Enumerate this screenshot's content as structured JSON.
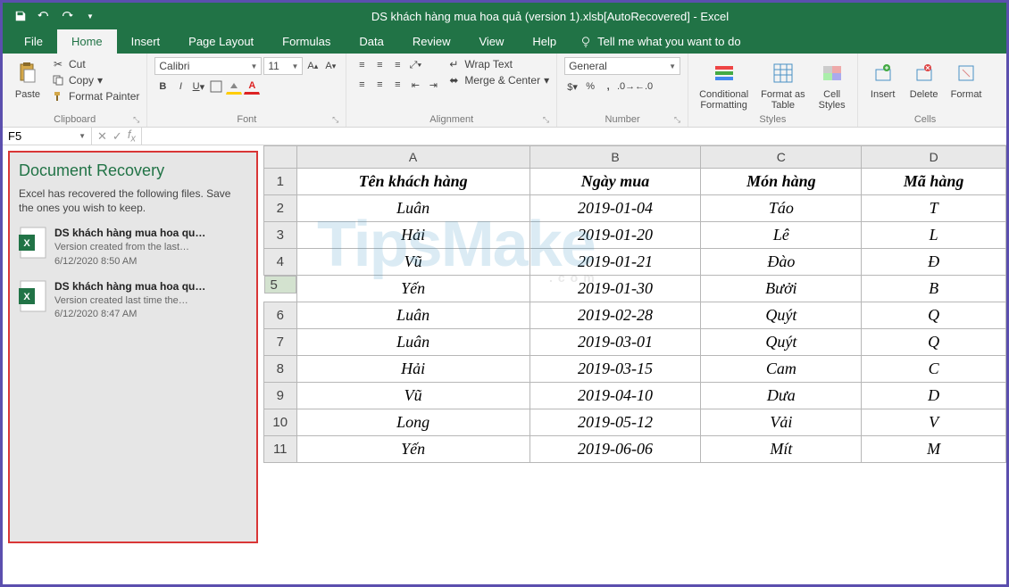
{
  "title": "DS khách hàng mua hoa quả (version 1).xlsb[AutoRecovered]  -  Excel",
  "tabs": [
    "File",
    "Home",
    "Insert",
    "Page Layout",
    "Formulas",
    "Data",
    "Review",
    "View",
    "Help"
  ],
  "tellme": "Tell me what you want to do",
  "ribbon": {
    "clipboard": {
      "label": "Clipboard",
      "paste": "Paste",
      "cut": "Cut",
      "copy": "Copy",
      "painter": "Format Painter"
    },
    "font": {
      "label": "Font",
      "name": "Calibri",
      "size": "11"
    },
    "alignment": {
      "label": "Alignment",
      "wrap": "Wrap Text",
      "merge": "Merge & Center"
    },
    "number": {
      "label": "Number",
      "format": "General"
    },
    "styles": {
      "label": "Styles",
      "cond": "Conditional\nFormatting",
      "table": "Format as\nTable",
      "cell": "Cell\nStyles"
    },
    "cells": {
      "label": "Cells",
      "insert": "Insert",
      "delete": "Delete",
      "format": "Format"
    }
  },
  "namebox": "F5",
  "recovery": {
    "title": "Document Recovery",
    "desc": "Excel has recovered the following files.  Save the ones you wish to keep.",
    "items": [
      {
        "title": "DS khách hàng mua hoa qu…",
        "sub": "Version created from the last…",
        "time": "6/12/2020 8:50 AM"
      },
      {
        "title": "DS khách hàng mua hoa qu…",
        "sub": "Version created last time the…",
        "time": "6/12/2020 8:47 AM"
      }
    ]
  },
  "columns": [
    "A",
    "B",
    "C",
    "D"
  ],
  "selectedRow": 5,
  "rows": [
    {
      "n": 1,
      "a": "Tên khách hàng",
      "b": "Ngày mua",
      "c": "Món hàng",
      "d": "Mã hàng",
      "hdr": true
    },
    {
      "n": 2,
      "a": "Luân",
      "b": "2019-01-04",
      "c": "Táo",
      "d": "T"
    },
    {
      "n": 3,
      "a": "Hải",
      "b": "2019-01-20",
      "c": "Lê",
      "d": "L"
    },
    {
      "n": 4,
      "a": "Vũ",
      "b": "2019-01-21",
      "c": "Đào",
      "d": "Đ"
    },
    {
      "n": 5,
      "a": "Yến",
      "b": "2019-01-30",
      "c": "Bưởi",
      "d": "B"
    },
    {
      "n": 6,
      "a": "Luân",
      "b": "2019-02-28",
      "c": "Quýt",
      "d": "Q"
    },
    {
      "n": 7,
      "a": "Luân",
      "b": "2019-03-01",
      "c": "Quýt",
      "d": "Q"
    },
    {
      "n": 8,
      "a": "Hải",
      "b": "2019-03-15",
      "c": "Cam",
      "d": "C"
    },
    {
      "n": 9,
      "a": "Vũ",
      "b": "2019-04-10",
      "c": "Dưa",
      "d": "D"
    },
    {
      "n": 10,
      "a": "Long",
      "b": "2019-05-12",
      "c": "Vải",
      "d": "V"
    },
    {
      "n": 11,
      "a": "Yến",
      "b": "2019-06-06",
      "c": "Mít",
      "d": "M"
    }
  ],
  "watermark": {
    "text": "TipsMake",
    "sub": ".com"
  }
}
